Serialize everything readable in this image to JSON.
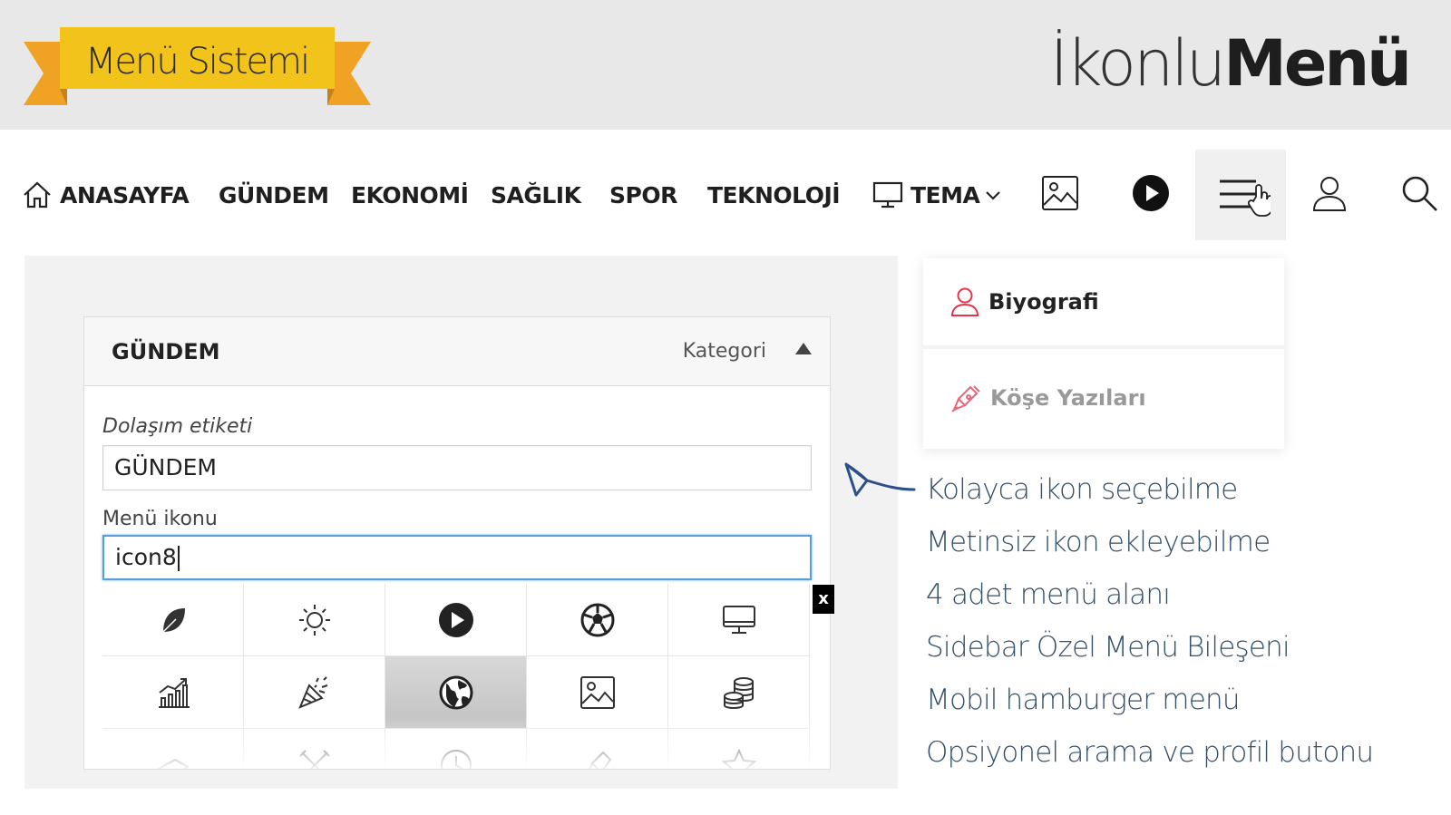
{
  "banner": {
    "ribbon_label": "Menü Sistemi",
    "title_light": "İkonlu",
    "title_bold": "Menü",
    "ribbon_color": "#f2c31a",
    "ribbon_tail_color": "#f0a224"
  },
  "nav": {
    "items": [
      {
        "label": "ANASAYFA",
        "icon": "home-icon"
      },
      {
        "label": "GÜNDEM"
      },
      {
        "label": "EKONOMİ"
      },
      {
        "label": "SAĞLIK"
      },
      {
        "label": "SPOR"
      },
      {
        "label": "TEKNOLOJİ"
      },
      {
        "label": "TEMA",
        "icon": "monitor-icon",
        "has_dropdown": true
      }
    ],
    "icon_buttons": [
      "image-icon",
      "play-icon",
      "hamburger-icon",
      "user-icon",
      "search-icon"
    ]
  },
  "dropdown": {
    "items": [
      {
        "label": "Biyografi",
        "icon": "user-outline-icon",
        "icon_color": "#e8334a"
      },
      {
        "label": "Köşe Yazıları",
        "icon": "pen-icon",
        "icon_color": "#e8334a"
      }
    ]
  },
  "menu_card": {
    "title": "GÜNDEM",
    "type_label": "Kategori",
    "nav_label_caption": "Dolaşım etiketi",
    "nav_label_value": "GÜNDEM",
    "icon_caption": "Menü ikonu",
    "icon_value": "icon8",
    "close_label": "x",
    "icon_grid": [
      "leaf-icon",
      "sun-icon",
      "play-icon",
      "football-icon",
      "monitor-icon",
      "chart-icon",
      "party-icon",
      "globe-icon",
      "image-icon",
      "coins-icon",
      "money-icon",
      "tools-icon",
      "clock-icon",
      "pen-icon",
      "star-icon"
    ],
    "selected_icon": "globe-icon"
  },
  "features": [
    "Kolayca ikon seçebilme",
    "Metinsiz ikon ekleyebilme",
    "4 adet menü alanı",
    "Sidebar Özel Menü Bileşeni",
    "Mobil hamburger menü",
    "Opsiyonel arama ve profil  butonu"
  ]
}
